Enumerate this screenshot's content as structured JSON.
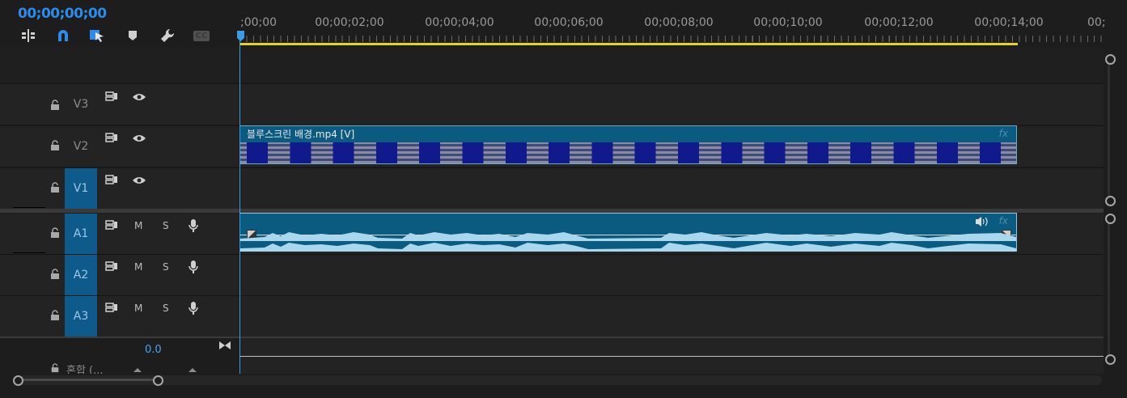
{
  "timecode": "00;00;00;00",
  "ruler_labels": [
    ";00;00",
    "00;00;02;00",
    "00;00;04;00",
    "00;00;06;00",
    "00;00;08;00",
    "00;00;10;00",
    "00;00;12;00",
    "00;00;14;00",
    "00;"
  ],
  "tools": [
    "insert-edit-icon",
    "snap-magnet-icon",
    "linked-selection-icon",
    "marker-icon",
    "wrench-icon",
    "captions-icon"
  ],
  "tools_captions": "CC",
  "tracks": {
    "v3": {
      "name": "V3"
    },
    "v2": {
      "name": "V2"
    },
    "v1": {
      "name": "V1"
    },
    "a1": {
      "name": "A1",
      "m": "M",
      "s": "S"
    },
    "a2": {
      "name": "A2",
      "m": "M",
      "s": "S"
    },
    "a3": {
      "name": "A3",
      "m": "M",
      "s": "S"
    }
  },
  "mix": {
    "label": "혼합 (...",
    "value": "0.0"
  },
  "video_clip": {
    "label": "블루스크린 배경.mp4 [V]",
    "fx": "fx"
  },
  "audio_clip": {
    "fx": "fx"
  },
  "colors": {
    "accent": "#2d8ceb",
    "clip": "#0b5a80",
    "workarea": "#e6d416",
    "playhead": "#3a9de8",
    "track_target": "#0e5a8a"
  }
}
